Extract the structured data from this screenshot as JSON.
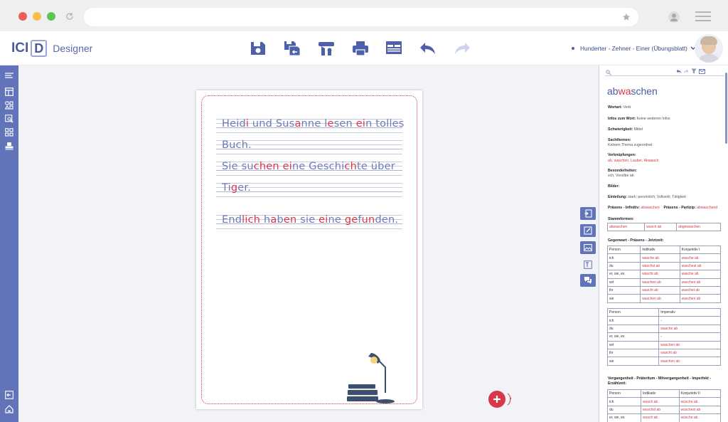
{
  "app": {
    "logo_ici": "ICI",
    "logo_d": "D",
    "logo_designer": "Designer",
    "worksheet_title": "Hunderter - Zehner - Einer (Übungsblatt)"
  },
  "colors": {
    "accent": "#6173b9",
    "red": "#d6374a",
    "text_blue": "#6d7bb7"
  },
  "toolbar": [
    "save-icon",
    "save-as-icon",
    "upload-icon",
    "print-icon",
    "preview-icon",
    "undo-icon",
    "redo-icon"
  ],
  "worksheet": {
    "lines": [
      [
        [
          "Heid",
          ""
        ],
        [
          "i",
          "r"
        ],
        [
          " und Sus",
          ""
        ],
        [
          "a",
          "r"
        ],
        [
          "nne l",
          ""
        ],
        [
          "e",
          "r"
        ],
        [
          "sen ",
          ""
        ],
        [
          "ei",
          "r"
        ],
        [
          "n tolles",
          ""
        ]
      ],
      [
        [
          "Buch.",
          ""
        ]
      ],
      [
        [
          "Sie su",
          ""
        ],
        [
          "chen",
          "r"
        ],
        [
          " ",
          ""
        ],
        [
          "ei",
          "r"
        ],
        [
          "ne Geschi",
          ""
        ],
        [
          "ch",
          "r"
        ],
        [
          "te über",
          ""
        ]
      ],
      [
        [
          "Ti",
          ""
        ],
        [
          "g",
          "r"
        ],
        [
          "er.",
          ""
        ]
      ],
      [
        [
          "End",
          ""
        ],
        [
          "lich",
          "r"
        ],
        [
          " h",
          ""
        ],
        [
          "a",
          "r"
        ],
        [
          "b",
          ""
        ],
        [
          "en",
          "r"
        ],
        [
          " sie ",
          ""
        ],
        [
          "ei",
          "r"
        ],
        [
          "ne ",
          ""
        ],
        [
          "ge",
          "r"
        ],
        [
          "f",
          ""
        ],
        [
          "un",
          "r"
        ],
        [
          "den.",
          ""
        ]
      ]
    ]
  },
  "panel": {
    "word_pre": "ab",
    "word_red": "wa",
    "word_post": "schen",
    "wortart_label": "Wortart:",
    "wortart_value": "Verb",
    "infos_label": "Infos zum Wort:",
    "infos_value": "Keine weiteren Infos",
    "schwierigkeit_label": "Schwierigkeit:",
    "schwierigkeit_value": "Mittel",
    "sachthemen_label": "Sachthemen:",
    "sachthemen_value": "Keinem Thema zugeordnet",
    "verknuepfungen_label": "Verknüpfungen:",
    "verknuepfungen_value": "ab, waschen, Lauber, Abwasch",
    "besonderheiten_label": "Besonderheiten:",
    "besonderheiten_value": "sch, Vorsilbe ab",
    "bilder_label": "Bilder:",
    "einteilung_label": "Einteilung:",
    "einteilung_value": "stark; persönlich; Vollverb; Tätigkeit",
    "praesens_inf_label": "Präsens - Infinitiv:",
    "praesens_inf_value": "abwaschen",
    "praesens_part_label": "Präsens - Partizip:",
    "praesens_part_value": "abwaschend",
    "stammformen_label": "Stammformen:",
    "stammformen": [
      "abwaschen",
      "wusch ab",
      "abgewaschen"
    ],
    "gegenwart_label": "Gegenwart - Präsens - Jetztzeit:",
    "gegenwart_headers": [
      "Person",
      "Indikativ",
      "Konjunktiv I"
    ],
    "gegenwart_rows": [
      [
        "ich",
        "wasche ab",
        "wasche ab"
      ],
      [
        "du",
        "wäschst ab",
        "waschest ab"
      ],
      [
        "er, sie, es",
        "wäscht ab",
        "wasche ab"
      ],
      [
        "wir",
        "waschen ab",
        "waschen ab"
      ],
      [
        "ihr",
        "wascht ab",
        "waschet ab"
      ],
      [
        "sie",
        "waschen ab",
        "waschen ab"
      ]
    ],
    "imperativ_headers": [
      "Person",
      "Imperativ"
    ],
    "imperativ_rows": [
      [
        "ich",
        "-"
      ],
      [
        "du",
        "wasche ab"
      ],
      [
        "er, sie, es",
        "-"
      ],
      [
        "wir",
        "waschen ab"
      ],
      [
        "ihr",
        "wascht ab"
      ],
      [
        "sie",
        "waschen ab"
      ]
    ],
    "vergangenheit_label": "Vergangenheit - Präteritum - Mitvergangenheit - Imperfekt - Erzählzeit:",
    "vergangenheit_headers": [
      "Person",
      "Indikativ",
      "Konjunktiv II"
    ],
    "vergangenheit_rows": [
      [
        "ich",
        "wusch ab",
        "wüsche ab"
      ],
      [
        "du",
        "wuschst ab",
        "wüschest ab"
      ],
      [
        "er, sie, es",
        "wusch ab",
        "wüsche ab"
      ]
    ]
  }
}
